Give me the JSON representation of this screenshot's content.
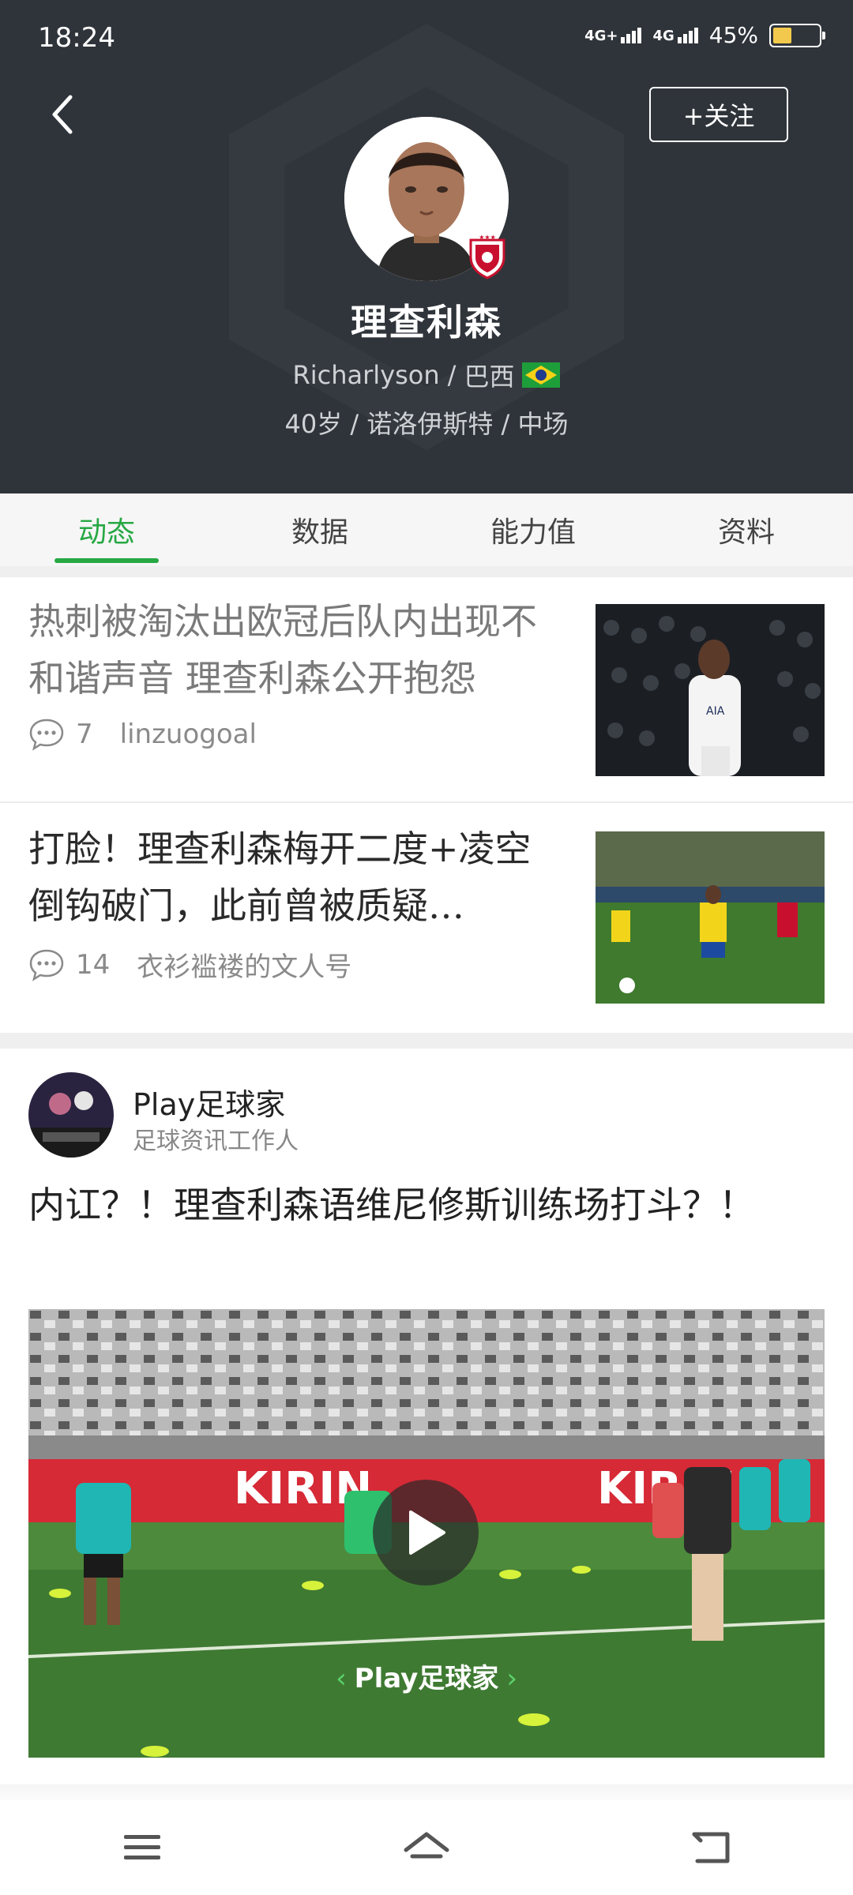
{
  "status_bar": {
    "time": "18:24",
    "net1_label": "4G+",
    "net2_label": "4G",
    "battery_text": "45%",
    "battery_level": 0.45
  },
  "header": {
    "follow_label": "+关注",
    "player_name": "理查利森",
    "player_name_latin": "Richarlyson",
    "country": "巴西",
    "age": "40岁",
    "club": "诺洛伊斯特",
    "position": "中场",
    "sep": "/",
    "colors": {
      "bg": "#2f343a",
      "accent": "#27a844"
    }
  },
  "tabs": [
    {
      "label": "动态",
      "active": true
    },
    {
      "label": "数据",
      "active": false
    },
    {
      "label": "能力值",
      "active": false
    },
    {
      "label": "资料",
      "active": false
    }
  ],
  "news": [
    {
      "title": "热刺被淘汰出欧冠后队内出现不和谐声音 理查利森公开抱怨",
      "comments": "7",
      "source": "linzuogoal",
      "read": true
    },
    {
      "title": "打脸！理查利森梅开二度+凌空倒钩破门，此前曾被质疑…",
      "comments": "14",
      "source": "衣衫褴褛的文人号",
      "read": false
    }
  ],
  "post": {
    "author": "Play足球家",
    "author_role": "足球资讯工作人",
    "title": "内讧？！理查利森语维尼修斯训练场打斗？！",
    "watermark": "Play足球家",
    "board_text": "KIRIN"
  },
  "icons": {
    "back": "back-arrow-icon",
    "comment": "comment-bubble-icon",
    "play": "play-icon",
    "menu": "menu-icon",
    "home": "home-icon",
    "return": "return-icon"
  }
}
